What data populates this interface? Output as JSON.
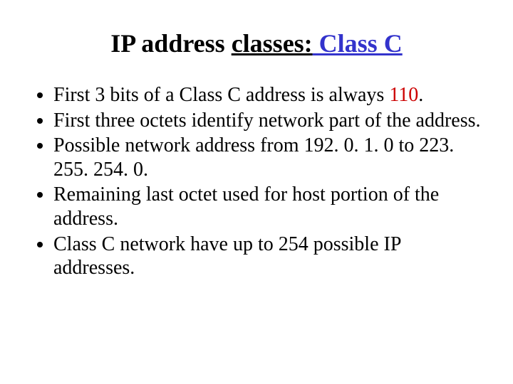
{
  "title": {
    "prefix": "IP address ",
    "underlined": "classes:",
    "blue": " Class C"
  },
  "bullets": {
    "b0_a": "First 3 bits of a Class C address is always ",
    "b0_red": "110",
    "b0_b": ".",
    "b1": "First three octets identify network part of the address.",
    "b2": "Possible network address from 192. 0. 1. 0 to 223. 255. 254. 0.",
    "b3": "Remaining last octet used for host portion of the address.",
    "b4": "Class C network have up to 254 possible IP addresses."
  }
}
